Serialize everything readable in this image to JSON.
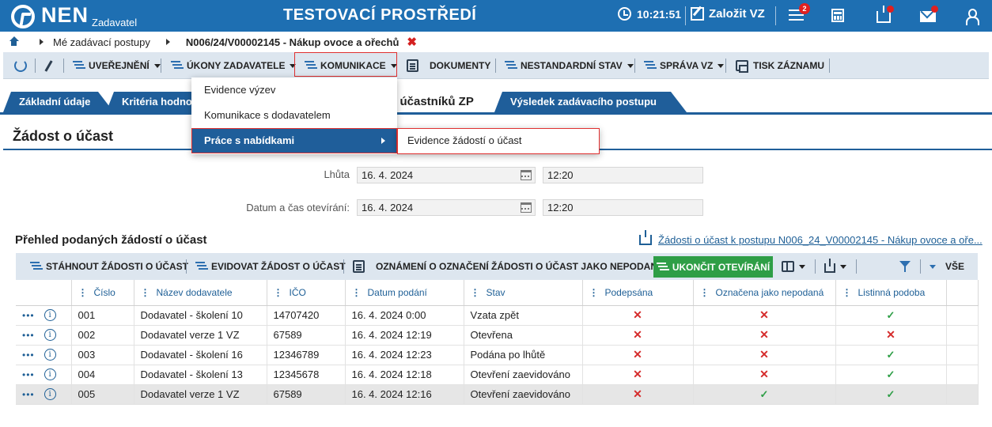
{
  "header": {
    "logo_text": "NEN",
    "logo_sub": "Zadavatel",
    "environment": "TESTOVACÍ PROSTŘEDÍ",
    "time": "10:21:51",
    "create_vz": "Založit VZ",
    "notifications_count": "2"
  },
  "breadcrumb": {
    "item1": "Mé zadávací postupy",
    "item2": "N006/24/V00002145 - Nákup ovoce a ořechů",
    "close": "✖"
  },
  "toolbar": {
    "uverejneni": "UVEŘEJNĚNÍ",
    "ukony": "ÚKONY ZADAVATELE",
    "komunikace": "KOMUNIKACE",
    "dokumenty": "DOKUMENTY",
    "nestandardni": "NESTANDARDNÍ STAV",
    "sprava": "SPRÁVA VZ",
    "tisk": "TISK ZÁZNAMU"
  },
  "tabs": {
    "t1": "Základní údaje",
    "t2": "Kritéria hodno",
    "t3": "ní účastníků ZP",
    "t4": "Výsledek zadávacího postupu"
  },
  "dropdown": {
    "item1": "Evidence výzev",
    "item2": "Komunikace s dodavatelem",
    "item3": "Práce s nabídkami",
    "submenu1": "Evidence žádostí o účast"
  },
  "section": {
    "title": "Žádost o účast",
    "lhuta_label": "Lhůta",
    "lhuta_date": "16. 4. 2024",
    "lhuta_time": "12:20",
    "otevirani_label": "Datum a čas otevírání:",
    "otevirani_date": "16. 4. 2024",
    "otevirani_time": "12:20"
  },
  "overview": {
    "title": "Přehled podaných žádostí o účast",
    "export_link": "Žádosti o účast k postupu N006_24_V00002145 - Nákup ovoce a oře..."
  },
  "grid_toolbar": {
    "stahnout": "STÁHNOUT ŽÁDOSTI O ÚČAST",
    "evidovat": "EVIDOVAT ŽÁDOST O ÚČAST",
    "oznameni": "OZNÁMENÍ O OZNAČENÍ ŽÁDOSTI O ÚČAST JAKO NEPODANÉ",
    "ukoncit": "UKONČIT OTEVÍRÁNÍ",
    "vse": "VŠE"
  },
  "table": {
    "columns": [
      "Číslo",
      "Název dodavatele",
      "IČO",
      "Datum podání",
      "Stav",
      "Podepsána",
      "Označena jako nepodaná",
      "Listinná podoba"
    ],
    "rows": [
      {
        "cislo": "001",
        "nazev": "Dodavatel - školení 10",
        "ico": "14707420",
        "datum": "16. 4. 2024 0:00",
        "stav": "Vzata zpět",
        "podepsana": "✕",
        "nepodana": "✕",
        "listinna": "✓",
        "sel": false
      },
      {
        "cislo": "002",
        "nazev": "Dodavatel verze 1 VZ",
        "ico": "67589",
        "datum": "16. 4. 2024 12:19",
        "stav": "Otevřena",
        "podepsana": "✕",
        "nepodana": "✕",
        "listinna": "✕",
        "sel": false
      },
      {
        "cislo": "003",
        "nazev": "Dodavatel - školení 16",
        "ico": "12346789",
        "datum": "16. 4. 2024 12:23",
        "stav": "Podána po lhůtě",
        "podepsana": "✕",
        "nepodana": "✕",
        "listinna": "✓",
        "sel": false
      },
      {
        "cislo": "004",
        "nazev": "Dodavatel - školení 13",
        "ico": "12345678",
        "datum": "16. 4. 2024 12:18",
        "stav": "Otevření zaevidováno",
        "podepsana": "✕",
        "nepodana": "✕",
        "listinna": "✓",
        "sel": false
      },
      {
        "cislo": "005",
        "nazev": "Dodavatel verze 1 VZ",
        "ico": "67589",
        "datum": "16. 4. 2024 12:16",
        "stav": "Otevření zaevidováno",
        "podepsana": "✕",
        "nepodana": "✓",
        "listinna": "✓",
        "sel": true
      }
    ]
  },
  "colors": {
    "header_blue": "#1e6fb2",
    "tab_blue": "#1f5e9a",
    "green": "#2e9e46",
    "red": "#d52b2b",
    "toolbar_bg": "#dde6ef"
  }
}
